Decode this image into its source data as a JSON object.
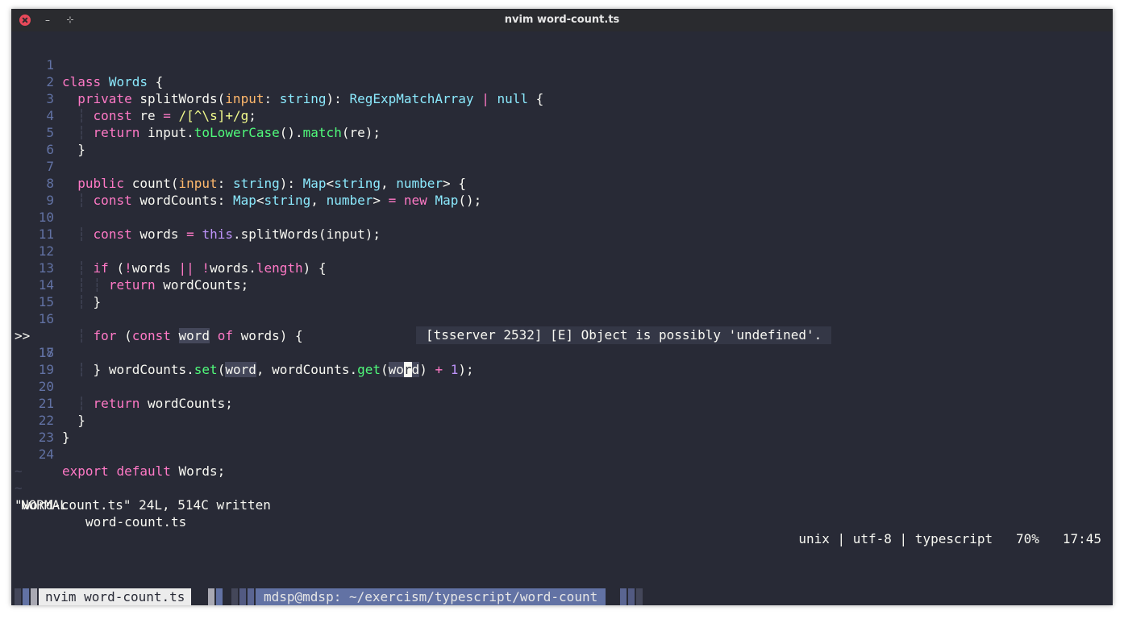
{
  "window": {
    "title": "nvim word-count.ts"
  },
  "titlebar_icons": {
    "close": "close-icon",
    "minimize": "minimize-icon",
    "maximize": "maximize-icon"
  },
  "editor": {
    "colors": {
      "background": "#282a36",
      "keyword": "#ff79c6",
      "type": "#8be9fd",
      "param": "#ffb86c",
      "function": "#50fa7b",
      "string": "#f1fa8c",
      "number": "#bd93f9",
      "linenr": "#6272a4"
    },
    "sign_marker": ">>",
    "sign_line": 17,
    "tilde": "~",
    "lines": [
      {
        "n": "1",
        "text": "class Words {"
      },
      {
        "n": "2",
        "text": "  private splitWords(input: string): RegExpMatchArray | null {"
      },
      {
        "n": "3",
        "text": "  ┆ const re = /[^\\s]+/g;"
      },
      {
        "n": "4",
        "text": "  ┆ return input.toLowerCase().match(re);"
      },
      {
        "n": "5",
        "text": "  }"
      },
      {
        "n": "6",
        "text": ""
      },
      {
        "n": "7",
        "text": "  public count(input: string): Map<string, number> {"
      },
      {
        "n": "8",
        "text": "  ┆ const wordCounts: Map<string, number> = new Map();"
      },
      {
        "n": "9",
        "text": ""
      },
      {
        "n": "10",
        "text": "  ┆ const words = this.splitWords(input);"
      },
      {
        "n": "11",
        "text": ""
      },
      {
        "n": "12",
        "text": "  ┆ if (!words || !words.length) {"
      },
      {
        "n": "13",
        "text": "  ┆ ┆ return wordCounts;"
      },
      {
        "n": "14",
        "text": "  ┆ }"
      },
      {
        "n": "15",
        "text": ""
      },
      {
        "n": "16",
        "text": "  ┆ for (const word of words) {"
      },
      {
        "n": "17",
        "text": "  ┆ ┆ wordCounts.set(word, wordCounts.get(word) + 1);"
      },
      {
        "n": "18",
        "text": "  ┆ }"
      },
      {
        "n": "19",
        "text": ""
      },
      {
        "n": "20",
        "text": "  ┆ return wordCounts;"
      },
      {
        "n": "21",
        "text": "  }"
      },
      {
        "n": "22",
        "text": "}"
      },
      {
        "n": "23",
        "text": ""
      },
      {
        "n": "24",
        "text": "export default Words;"
      }
    ],
    "diagnostic": "[tsserver 2532] [E] Object is possibly 'undefined'."
  },
  "statusline": {
    "mode": "NORMAL",
    "filename": "word-count.ts",
    "right": "unix | utf-8 | typescript   70%   17:45"
  },
  "message": "\"word-count.ts\" 24L, 514C written",
  "tmux": {
    "active_window": "nvim word-count.ts",
    "path": "mdsp@mdsp: ~/exercism/typescript/word-count"
  }
}
